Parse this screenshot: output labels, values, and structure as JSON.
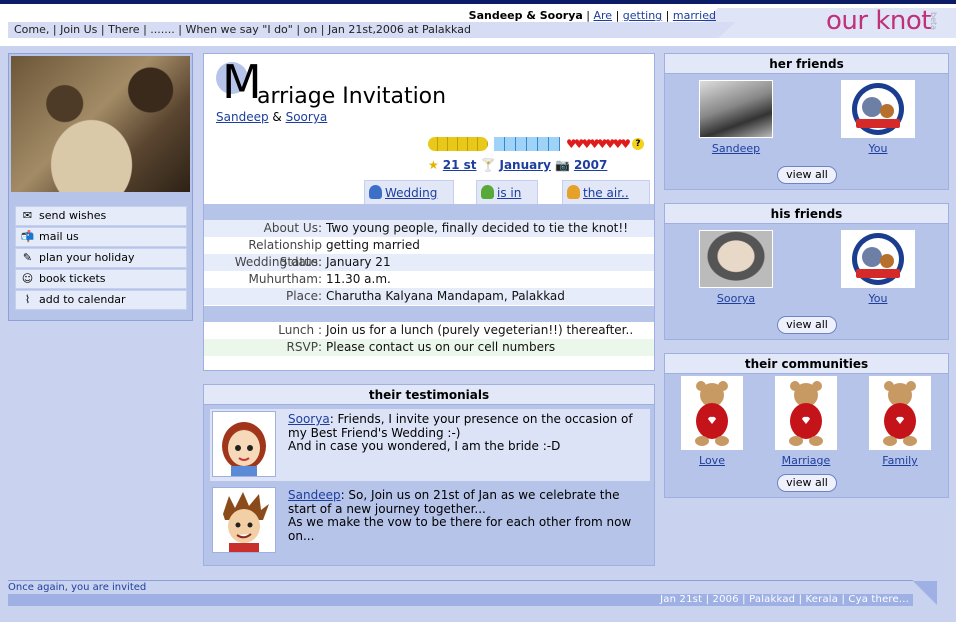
{
  "header": {
    "names": "Sandeep & Soorya",
    "links": [
      "Are",
      "getting",
      "married"
    ],
    "band_text": "Come, | Join Us | There | ....... | When we say \"I do\" | on | Jan 21st,2006 at Palakkad",
    "logo": "our knot",
    "beta": "beta"
  },
  "left": {
    "actions": [
      {
        "icon": "envelope-icon",
        "label": "send wishes"
      },
      {
        "icon": "mail-icon",
        "label": "mail us"
      },
      {
        "icon": "pen-icon",
        "label": "plan your holiday"
      },
      {
        "icon": "smiley-icon",
        "label": "book tickets"
      },
      {
        "icon": "paperclip-icon",
        "label": "add to calendar"
      }
    ]
  },
  "invite": {
    "title_initial": "M",
    "title_rest": "arriage Invitation",
    "groom": "Sandeep",
    "amp": "&",
    "bride": "Soorya",
    "date": {
      "day": "21 st",
      "month": "January",
      "year": "2007"
    },
    "qmark": "?",
    "tabs": [
      "Wedding",
      "is in",
      "the air.."
    ],
    "details": [
      {
        "k": "About Us:",
        "v": "Two young people, finally decided to tie the knot!!"
      },
      {
        "k": "Relationship Status:",
        "v": "getting married"
      },
      {
        "k": "Wedding date:",
        "v": "January 21"
      },
      {
        "k": "Muhurtham:",
        "v": "11.30 a.m."
      },
      {
        "k": "Place:",
        "v": "Charutha Kalyana Mandapam, Palakkad"
      }
    ],
    "details2": [
      {
        "k": "Lunch :",
        "v": "Join us for a lunch (purely vegeterian!!) thereafter.."
      },
      {
        "k": "RSVP:",
        "v": "Please contact us on our cell numbers"
      }
    ]
  },
  "testimonials": {
    "title": "their testimonials",
    "items": [
      {
        "author": "Soorya",
        "lines": [
          ": Friends, I invite your presence on the occasion of",
          "my Best Friend's Wedding :-)",
          "And in case you wondered, I am the bride :-D"
        ]
      },
      {
        "author": "Sandeep",
        "lines": [
          ": So, Join us on 21st of Jan as we celebrate the",
          "start of a new journey together...",
          "As we make the vow to be there for each other from now",
          "on..."
        ]
      }
    ]
  },
  "her_friends": {
    "title": "her friends",
    "friends": [
      "Sandeep",
      "You"
    ],
    "view_all": "view all"
  },
  "his_friends": {
    "title": "his friends",
    "friends": [
      "Soorya",
      "You"
    ],
    "view_all": "view all"
  },
  "communities": {
    "title": "their communities",
    "items": [
      "Love",
      "Marriage",
      "Family"
    ],
    "view_all": "view all"
  },
  "footer": {
    "text": "Once again, you are invited",
    "bar": "Jan 21st | 2006 | Palakkad | Kerala | Cya there..."
  }
}
